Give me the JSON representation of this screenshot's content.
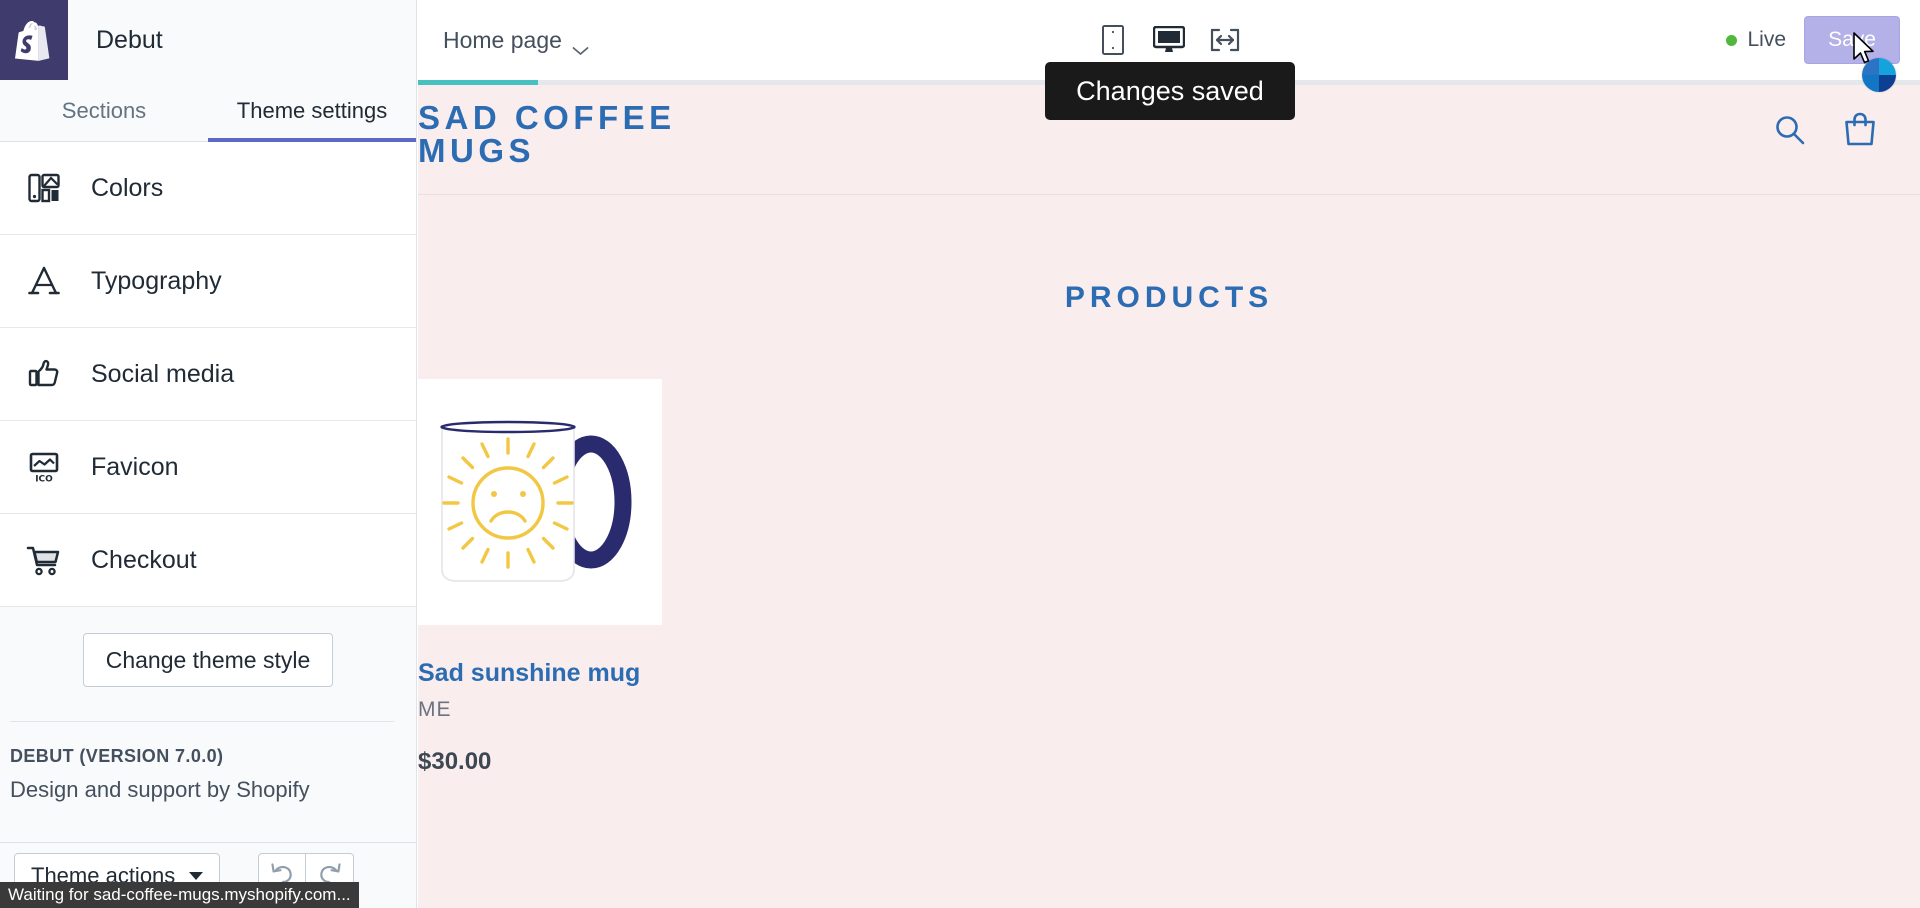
{
  "topbar": {
    "logo_icon": "shopify-bag-icon",
    "theme_name": "Debut",
    "page_selector": {
      "label": "Home page",
      "chevron_icon": "chevron-down-icon"
    },
    "devices": [
      {
        "name": "mobile",
        "icon": "mobile-icon"
      },
      {
        "name": "desktop",
        "icon": "desktop-icon",
        "selected": true
      },
      {
        "name": "full-width",
        "icon": "fullwidth-icon"
      }
    ],
    "status": {
      "label": "Live",
      "dot_color": "#50b83c"
    },
    "save_label": "Save",
    "save_disabled": true,
    "save_bg": "#b4b0e8"
  },
  "toast": {
    "message": "Changes saved",
    "bg": "#1a1a1a"
  },
  "sidebar": {
    "tabs": [
      {
        "label": "Sections",
        "active": false
      },
      {
        "label": "Theme settings",
        "active": true
      }
    ],
    "active_underline_color": "#5c6ac4",
    "items": [
      {
        "label": "Colors",
        "icon": "color-swatch-icon"
      },
      {
        "label": "Typography",
        "icon": "typography-a-icon"
      },
      {
        "label": "Social media",
        "icon": "thumbs-up-icon"
      },
      {
        "label": "Favicon",
        "icon": "favicon-ico-icon"
      },
      {
        "label": "Checkout",
        "icon": "shopping-cart-icon"
      }
    ],
    "change_style_label": "Change theme style",
    "version_title": "DEBUT (VERSION 7.0.0)",
    "version_subtitle": "Design and support by Shopify",
    "theme_actions_label": "Theme actions",
    "undo_icon": "undo-arrow-icon",
    "redo_icon": "redo-arrow-icon"
  },
  "statusbar": {
    "text": "Waiting for sad-coffee-mugs.myshopify.com..."
  },
  "preview": {
    "progress_percent": 8,
    "progress_color": "#47c1bf",
    "background": "#faeded",
    "accent_color": "#2b6cb3",
    "store_title": "SAD COFFEE MUGS",
    "search_icon": "search-icon",
    "cart_icon": "shopping-bag-icon",
    "section_heading": "PRODUCTS",
    "product": {
      "title": "Sad sunshine mug",
      "vendor": "ME",
      "price": "$30.00",
      "image_alt": "white-mug-with-sad-sun-icon",
      "mug_handle_color": "#2a2a6e",
      "sun_color": "#f2c744"
    }
  }
}
